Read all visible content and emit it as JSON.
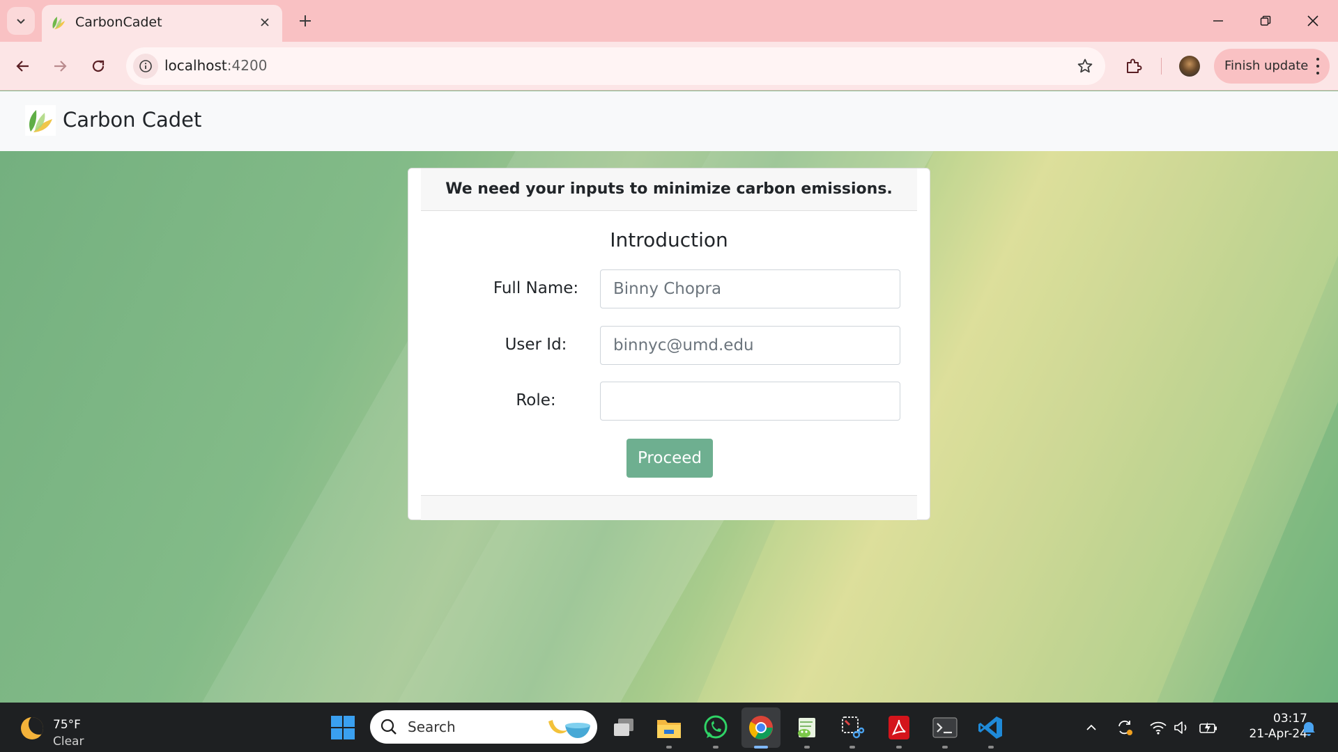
{
  "browser": {
    "tab": {
      "title": "CarbonCadet"
    },
    "url": {
      "host": "localhost",
      "port": ":4200"
    },
    "finish_update_label": "Finish update"
  },
  "app": {
    "name": "Carbon Cadet"
  },
  "card": {
    "header_text": "We need your inputs to minimize carbon emissions.",
    "title": "Introduction",
    "fields": [
      {
        "label": "Full Name:",
        "placeholder": "Binny Chopra",
        "value": ""
      },
      {
        "label": "User Id:",
        "placeholder": "binnyc@umd.edu",
        "value": ""
      },
      {
        "label": "Role:",
        "placeholder": "",
        "value": ""
      }
    ],
    "proceed_label": "Proceed"
  },
  "colors": {
    "accent": "#6eaf90",
    "tabbar": "#f9c1c3",
    "toolbar": "#fce5e6",
    "taskbar": "#1e2022"
  },
  "taskbar": {
    "weather": {
      "temp": "75°F",
      "condition": "Clear"
    },
    "search_label": "Search",
    "pinned": [
      "windows-start-icon",
      "task-view-icon",
      "file-explorer-icon",
      "whatsapp-icon",
      "chrome-icon",
      "notepad-plus-icon",
      "snipping-tool-icon",
      "acrobat-icon",
      "terminal-icon",
      "vscode-icon"
    ],
    "tray": [
      "chevron-up-icon",
      "sync-icon",
      "wifi-icon",
      "volume-icon",
      "battery-icon",
      "notification-bell-icon"
    ],
    "clock": {
      "time": "03:17",
      "date": "21-Apr-24"
    }
  }
}
